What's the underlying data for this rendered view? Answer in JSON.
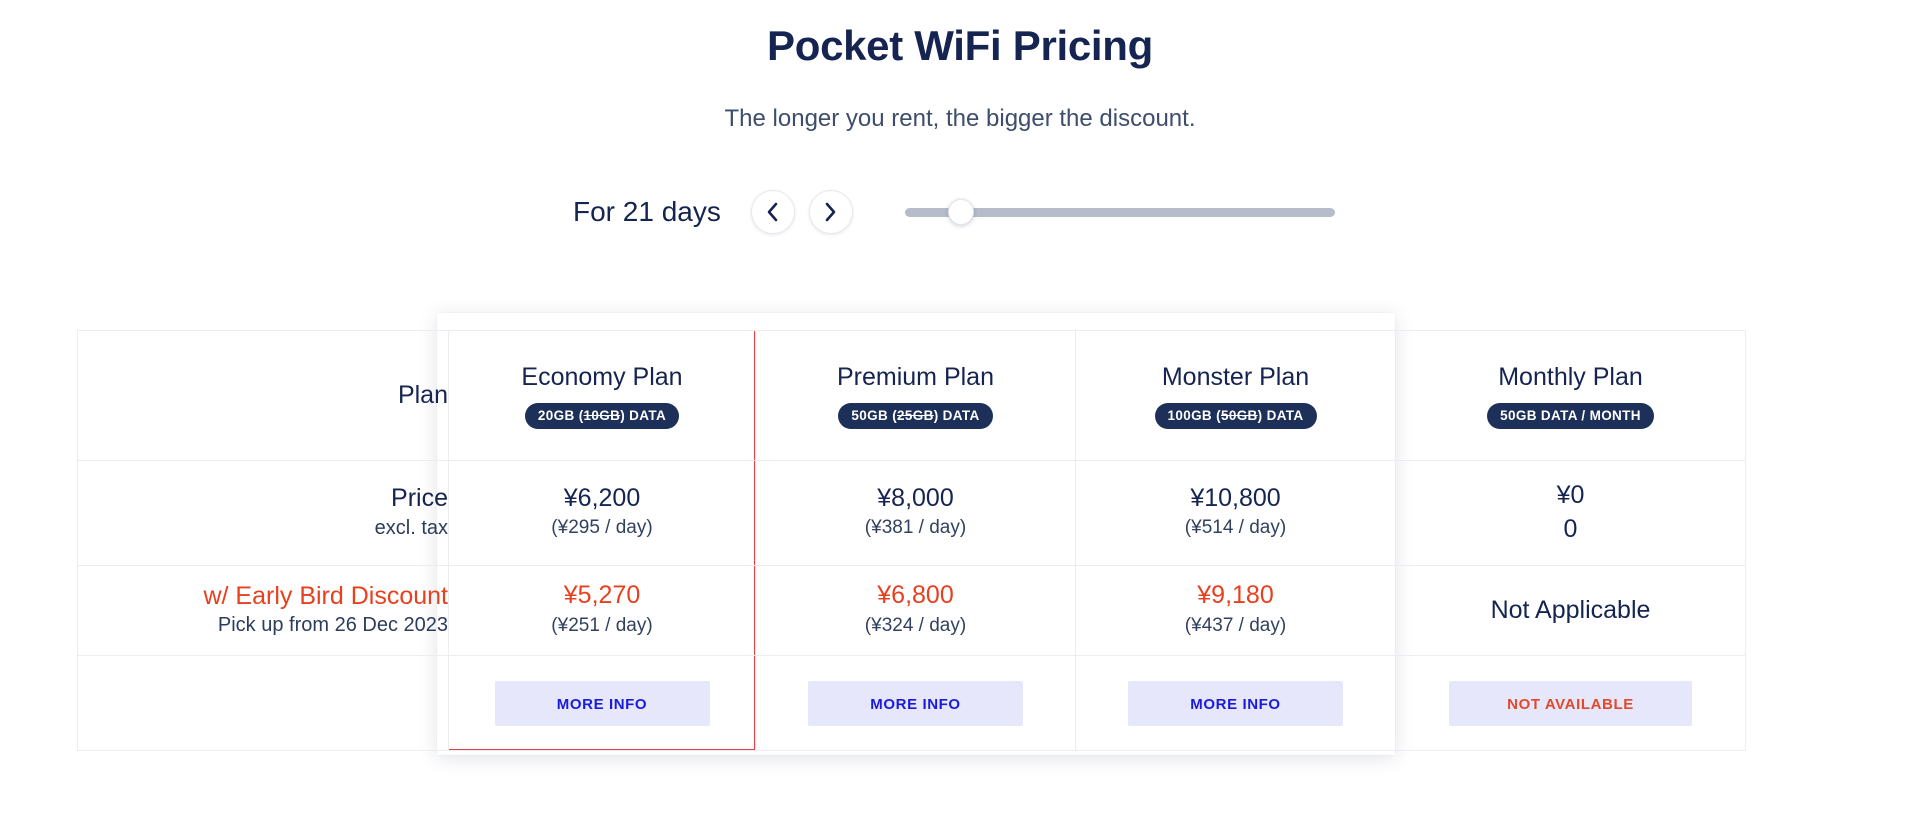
{
  "header": {
    "title": "Pocket WiFi Pricing",
    "subtitle": "The longer you rent, the bigger the discount."
  },
  "controls": {
    "duration_label": "For 21 days",
    "prev_icon": "chevron-left-icon",
    "next_icon": "chevron-right-icon",
    "slider": {
      "value_days": 21,
      "fill_percent": 10
    }
  },
  "table": {
    "row_labels": {
      "plan": "Plan",
      "price_main": "Price",
      "price_sub": "excl. tax",
      "discount_main": "w/ Early Bird Discount",
      "discount_sub": "Pick up from 26 Dec 2023"
    },
    "columns": [
      {
        "name": "Economy Plan",
        "badge_prefix": "20GB (",
        "badge_struck": "10GB",
        "badge_suffix": ") DATA",
        "price": "¥6,200",
        "price_per_day": "(¥295 / day)",
        "discount_price": "¥5,270",
        "discount_per_day": "(¥251 / day)",
        "button_label": "MORE INFO",
        "selected": true
      },
      {
        "name": "Premium Plan",
        "badge_prefix": "50GB (",
        "badge_struck": "25GB",
        "badge_suffix": ") DATA",
        "price": "¥8,000",
        "price_per_day": "(¥381 / day)",
        "discount_price": "¥6,800",
        "discount_per_day": "(¥324 / day)",
        "button_label": "MORE INFO",
        "selected": false
      },
      {
        "name": "Monster Plan",
        "badge_prefix": "100GB (",
        "badge_struck": "50GB",
        "badge_suffix": ") DATA",
        "price": "¥10,800",
        "price_per_day": "(¥514 / day)",
        "discount_price": "¥9,180",
        "discount_per_day": "(¥437 / day)",
        "button_label": "MORE INFO",
        "selected": false
      },
      {
        "name": "Monthly Plan",
        "badge_prefix": "50GB DATA / MONTH",
        "badge_struck": "",
        "badge_suffix": "",
        "price": "¥0",
        "price_per_day": "0",
        "discount_price": "Not Applicable",
        "discount_per_day": "",
        "button_label": "NOT AVAILABLE",
        "selected": false
      }
    ]
  },
  "colors": {
    "navy": "#152450",
    "accent_red": "#e8401e",
    "badge_bg": "#1d3059",
    "button_bg": "#e6e7fa",
    "button_text": "#1a1ae0",
    "button_na_text": "#e2492a",
    "highlight_border": "#e4404a",
    "slider_track": "#b6bcca"
  }
}
